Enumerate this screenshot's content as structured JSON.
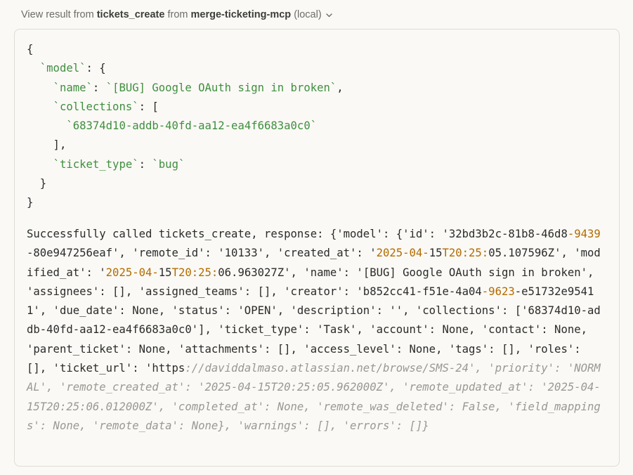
{
  "header": {
    "prefix": "View result from",
    "tool": "tickets_create",
    "from_word": "from",
    "server": "merge-ticketing-mcp",
    "scope": "(local)"
  },
  "request": {
    "open_brace": "{",
    "model_key": "`model`",
    "name_key": "`name`",
    "name_value": "`[BUG] Google OAuth sign in broken`",
    "collections_key": "`collections`",
    "collection_id": "`68374d10-addb-40fd-aa12-ea4f6683a0c0`",
    "ticket_type_key": "`ticket_type`",
    "ticket_type_value": "`bug`",
    "close_brace": "}"
  },
  "response": {
    "text_main": "Successfully called tickets_create, response: {'model': {'id': '32bd3b2c-81b8-46d8-9439-80e947256eaf', 'remote_id': '10133', 'created_at': '2025-04-15T20:25:05.107596Z', 'modified_at': '2025-04-15T20:25:06.963027Z', 'name': '[BUG] Google OAuth sign in broken', 'assignees': [], 'assigned_teams': [], 'creator': 'b852cc41-f51e-4a04-9623-e51732e95411', 'due_date': None, 'status': 'OPEN', 'description': '', 'collections': ['68374d10-addb-40fd-aa12-ea4f6683a0c0'], 'ticket_type': 'Task', 'account': None, 'contact': None, 'parent_ticket': None, 'attachments': [], 'access_level': None, 'tags': [], 'roles': [], 'ticket_url': 'https",
    "text_faded": "://daviddalmaso.atlassian.net/browse/SMS-24', 'priority': 'NORMAL', 'remote_created_at': '2025-04-15T20:25:05.962000Z', 'remote_updated_at': '2025-04-15T20:25:06.012000Z', 'completed_at': None, 'remote_was_deleted': False, 'field_mappings': None, 'remote_data': None}, 'warnings': [], 'errors': []}"
  }
}
